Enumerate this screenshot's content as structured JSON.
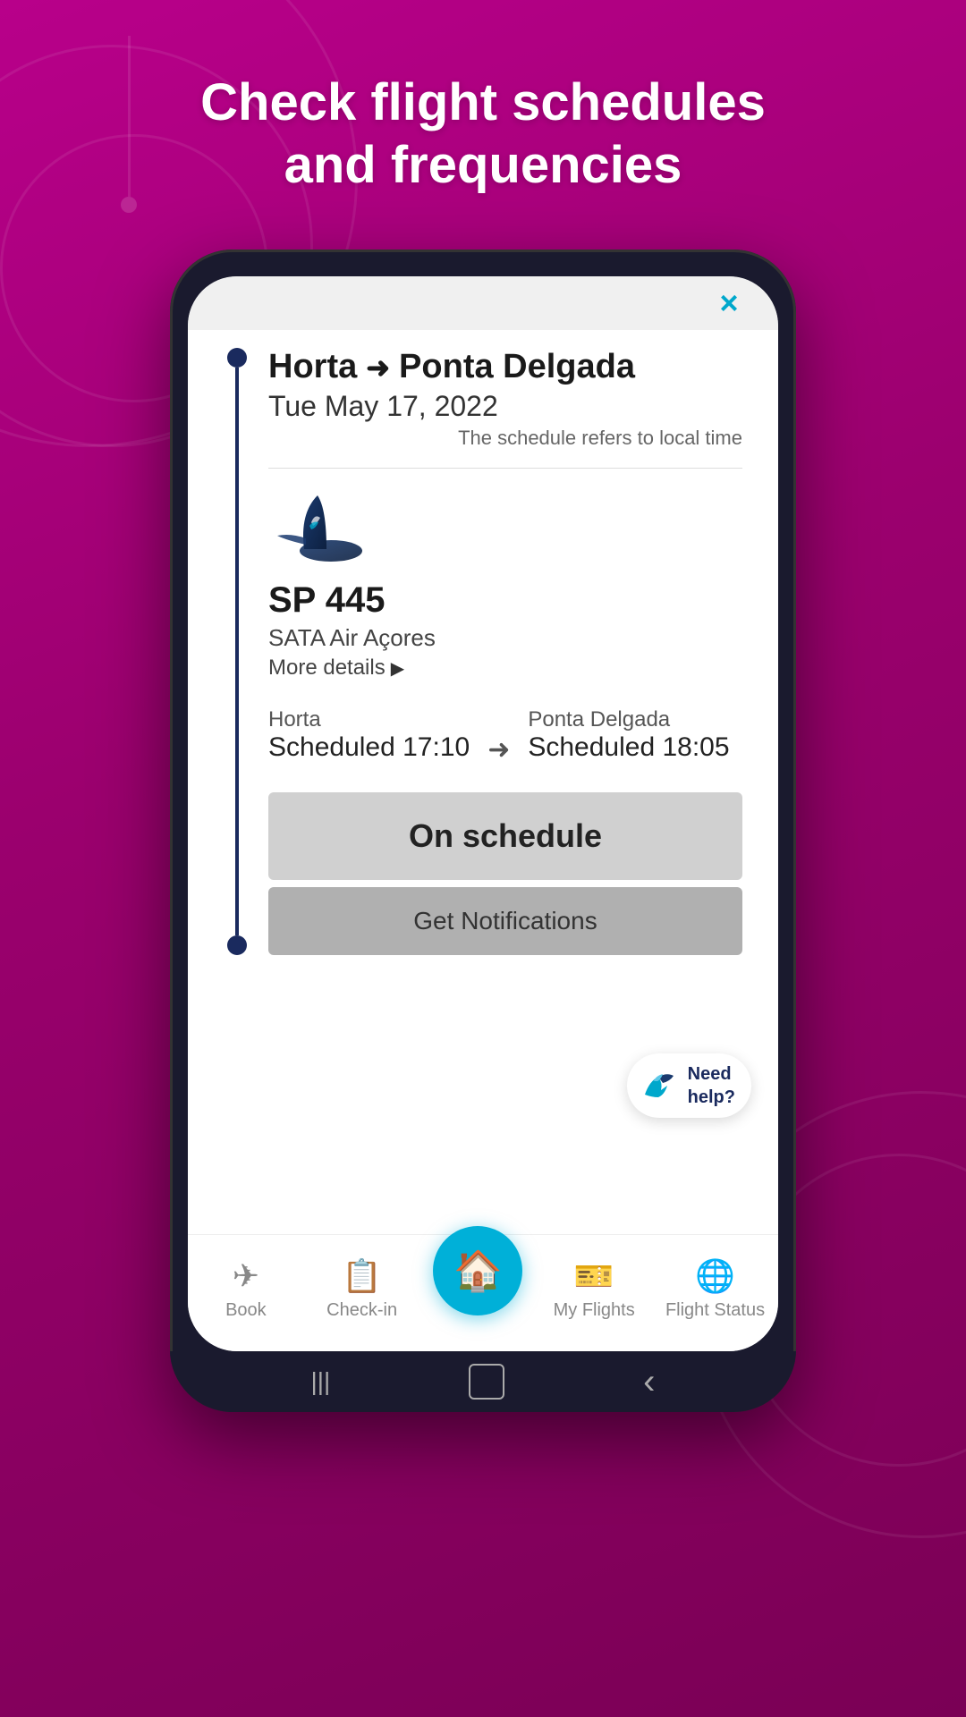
{
  "header": {
    "title_line1": "Check flight schedules",
    "title_line2": "and frequencies"
  },
  "modal": {
    "close_label": "×",
    "route": {
      "origin": "Horta",
      "destination": "Ponta Delgada",
      "date": "Tue May 17, 2022",
      "note": "The schedule refers to local time"
    },
    "flight": {
      "number": "SP 445",
      "airline": "SATA Air Açores",
      "more_details_label": "More details"
    },
    "schedule": {
      "origin_city": "Horta",
      "origin_time": "Scheduled 17:10",
      "destination_city": "Ponta Delgada",
      "destination_time": "Scheduled 18:05"
    },
    "status_label": "On schedule",
    "notifications_label": "Get Notifications",
    "help": {
      "label_line1": "Need",
      "label_line2": "help?"
    }
  },
  "bottom_nav": {
    "items": [
      {
        "icon": "✈",
        "label": "Book"
      },
      {
        "icon": "📱",
        "label": "Check-in"
      },
      {
        "icon": "🏠",
        "label": "Home"
      },
      {
        "icon": "🎫",
        "label": "My Flights"
      },
      {
        "icon": "🌐",
        "label": "Flight Status"
      }
    ]
  },
  "phone_nav": {
    "back": "‹",
    "home_circle": "○",
    "menu": "|||"
  }
}
